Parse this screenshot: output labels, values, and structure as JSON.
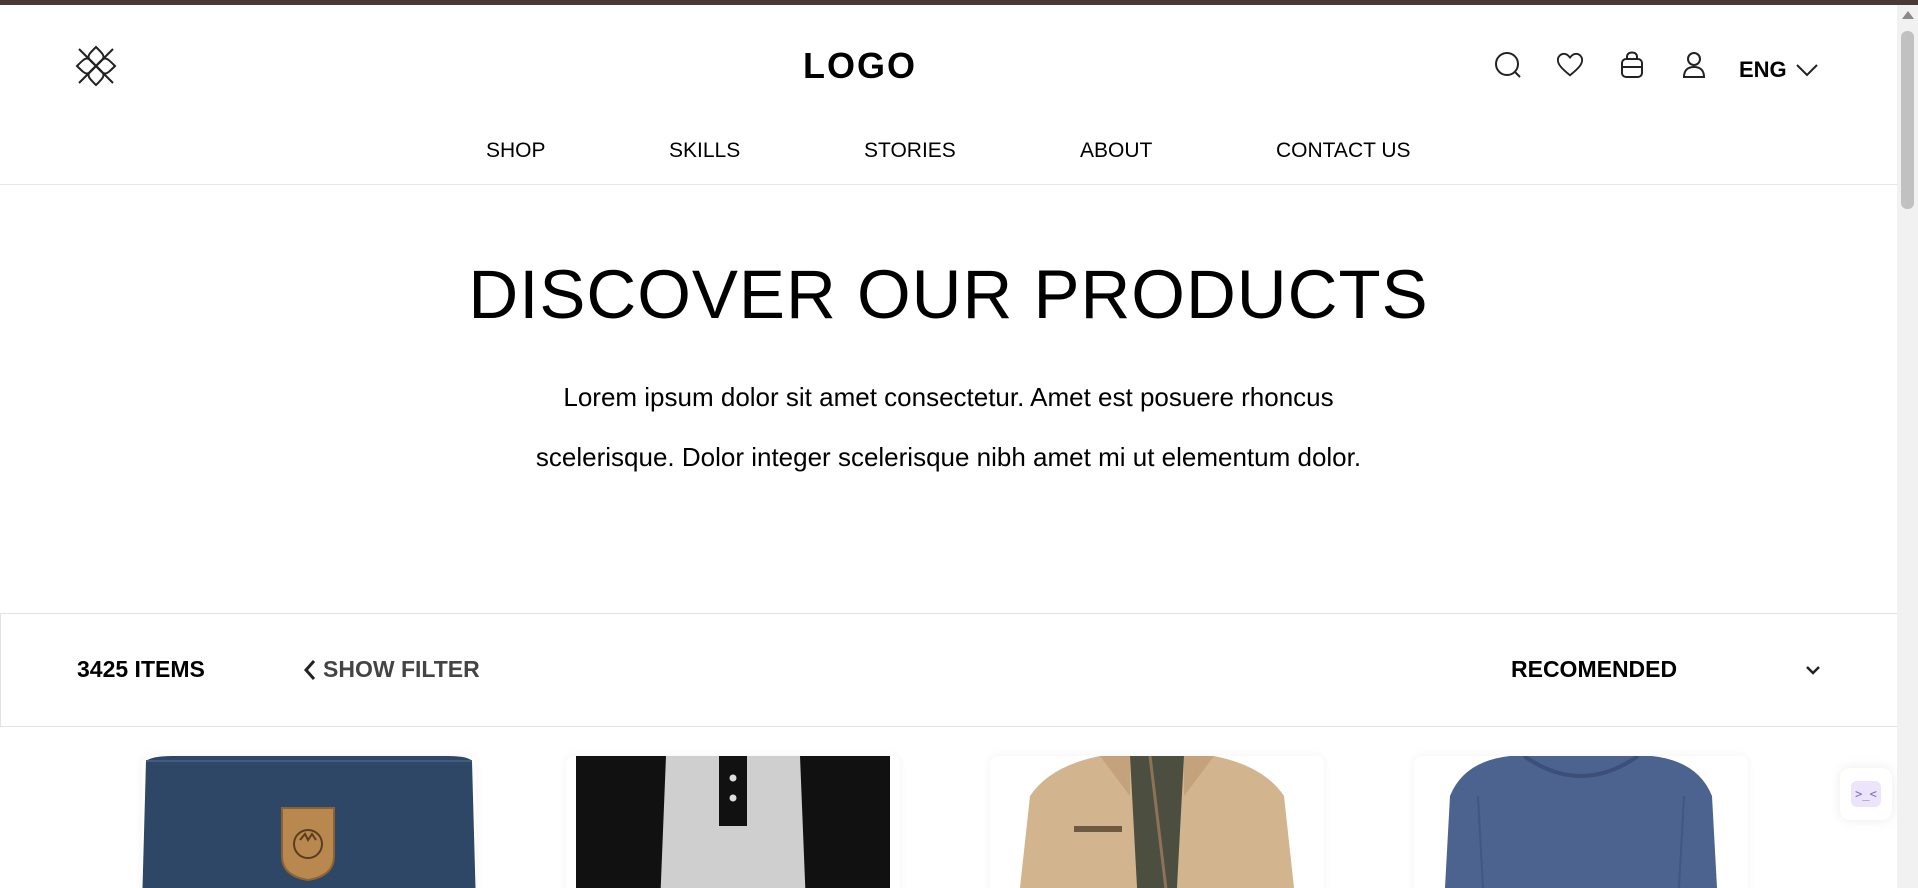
{
  "header": {
    "logo": "LOGO",
    "language": "ENG",
    "icons": [
      "search-icon",
      "heart-icon",
      "bag-icon",
      "user-icon"
    ]
  },
  "nav": {
    "items": [
      "SHOP",
      "SKILLS",
      "STORIES",
      "ABOUT",
      "CONTACT US"
    ]
  },
  "hero": {
    "title": "DISCOVER OUR PRODUCTS",
    "text": "Lorem ipsum dolor sit amet consectetur. Amet est posuere rhoncus scelerisque. Dolor integer scelerisque nibh amet mi ut elementum dolor."
  },
  "filter_bar": {
    "items_count": "3425 ITEMS",
    "show_filter": "SHOW FILTER",
    "sort_selected": "RECOMENDED"
  },
  "products": [
    {
      "image": "navy-backpack"
    },
    {
      "image": "raglan-henley-shirt"
    },
    {
      "image": "beige-jacket"
    },
    {
      "image": "blue-sweater"
    }
  ],
  "widget": {
    "label": ">_<"
  },
  "colors": {
    "topbar": "#4a3a36",
    "text": "#000000",
    "muted": "#444444",
    "divider": "#e6e6e6"
  }
}
